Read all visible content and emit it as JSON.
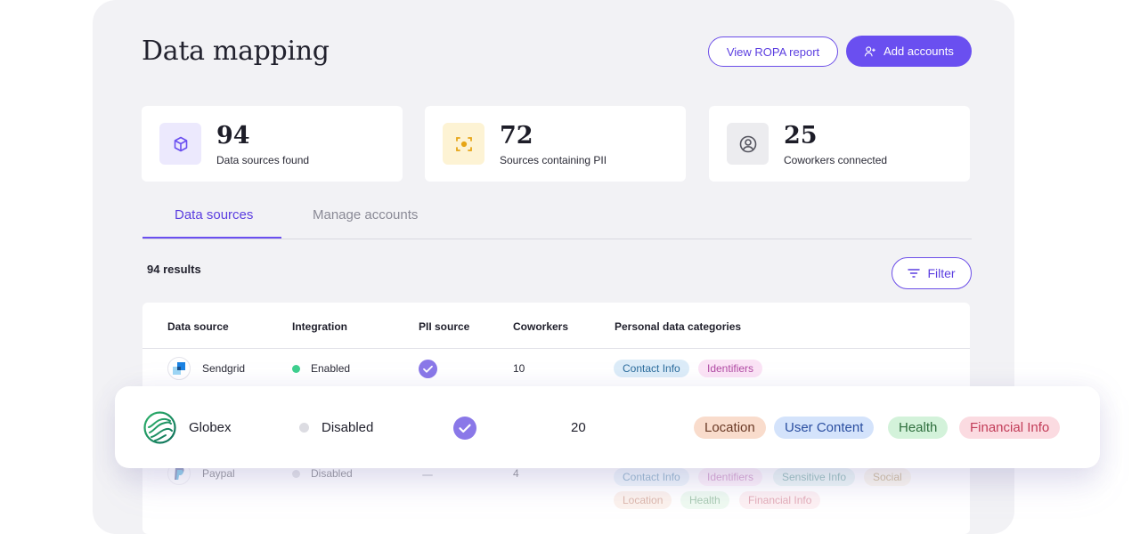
{
  "header": {
    "title": "Data mapping",
    "view_ropa_label": "View ROPA report",
    "add_accounts_label": "Add accounts"
  },
  "stats": [
    {
      "value": "94",
      "label": "Data sources found",
      "icon": "cube-icon",
      "color": "#6a4ff0",
      "bg": "#ece9fd"
    },
    {
      "value": "72",
      "label": "Sources containing PII",
      "icon": "scan-icon",
      "color": "#e6a516",
      "bg": "#fdf3d4"
    },
    {
      "value": "25",
      "label": "Coworkers connected",
      "icon": "user-circle-icon",
      "color": "#55555f",
      "bg": "#ececef"
    }
  ],
  "tabs": [
    {
      "label": "Data sources",
      "active": true
    },
    {
      "label": "Manage accounts",
      "active": false
    }
  ],
  "results_label": "94 results",
  "filter_label": "Filter",
  "table": {
    "headers": [
      "Data source",
      "Integration",
      "PII source",
      "Coworkers",
      "Personal data categories"
    ],
    "rows": [
      {
        "name": "Sendgrid",
        "integration": "Enabled",
        "integration_color": "#3ecf8e",
        "pii": true,
        "coworkers": "10",
        "tags": [
          {
            "label": "Contact Info",
            "bg": "#dcecf8",
            "fg": "#2b6c9c"
          },
          {
            "label": "Identifiers",
            "bg": "#fbe3f5",
            "fg": "#b04aa3"
          }
        ]
      },
      {
        "name": "Paypal",
        "integration": "Disabled",
        "integration_color": "#c9c9d1",
        "pii": false,
        "coworkers": "4",
        "tags": [
          {
            "label": "Contact Info",
            "bg": "#dcecf8",
            "fg": "#2b6c9c"
          },
          {
            "label": "Identifiers",
            "bg": "#fbe3f5",
            "fg": "#b04aa3"
          },
          {
            "label": "Sensitive Info",
            "bg": "#d9efee",
            "fg": "#2f7e7a"
          },
          {
            "label": "Social",
            "bg": "#f8efde",
            "fg": "#a07a38"
          },
          {
            "label": "Location",
            "bg": "#fae3d8",
            "fg": "#b2624a"
          },
          {
            "label": "Health",
            "bg": "#ddf5e2",
            "fg": "#3f8a55"
          },
          {
            "label": "Financial Info",
            "bg": "#fbe1e6",
            "fg": "#c24a63"
          }
        ]
      }
    ]
  },
  "highlight": {
    "name": "Globex",
    "integration": "Disabled",
    "integration_color": "#dcdce2",
    "pii": true,
    "coworkers": "20",
    "tags": [
      {
        "label": "Location",
        "bg": "#f9dccc",
        "fg": "#6a3a26"
      },
      {
        "label": "User Content",
        "bg": "#d4e3fb",
        "fg": "#2a4ea0"
      },
      {
        "label": "Health",
        "bg": "#d3f2da",
        "fg": "#2f6f3e"
      },
      {
        "label": "Financial Info",
        "bg": "#fbdbe1",
        "fg": "#c23c58"
      }
    ]
  }
}
